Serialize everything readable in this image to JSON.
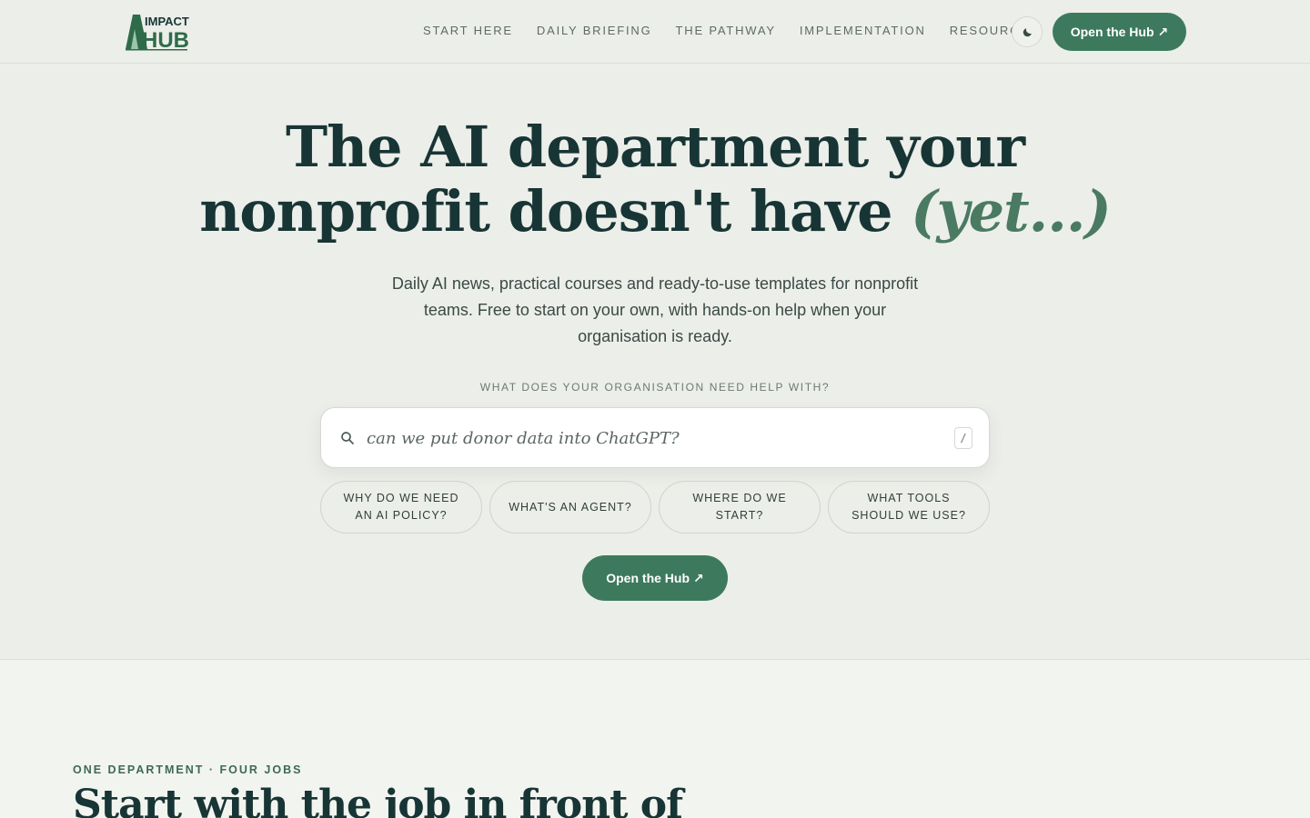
{
  "brand": {
    "logo_line1": "IMPACT",
    "logo_line2": "HUB",
    "brand_color": "#2f6b4a"
  },
  "nav": {
    "items": [
      {
        "label": "START HERE"
      },
      {
        "label": "DAILY BRIEFING"
      },
      {
        "label": "THE PATHWAY"
      },
      {
        "label": "IMPLEMENTATION"
      },
      {
        "label": "RESOURCES"
      }
    ],
    "theme_toggle_icon": "moon-icon",
    "cta_label": "Open the Hub",
    "cta_icon": "↗"
  },
  "hero": {
    "title_line1": "The AI department your",
    "title_line2": "nonprofit doesn't have",
    "title_accent": "(yet...)",
    "subtitle": "Daily AI news, practical courses and ready-to-use templates for nonprofit teams. Free to start on your own, with hands-on help when your organisation is ready.",
    "prompt_label": "WHAT DOES YOUR ORGANISATION NEED HELP WITH?",
    "search": {
      "value": "can we put donor data into ChatGPT?",
      "shortcut": "/",
      "icon": "search-icon"
    },
    "chips": [
      {
        "label": "WHY DO WE NEED AN AI POLICY?"
      },
      {
        "label": "WHAT'S AN AGENT?"
      },
      {
        "label": "WHERE DO WE START?"
      },
      {
        "label": "WHAT TOOLS SHOULD WE USE?"
      }
    ],
    "cta_label": "Open the Hub",
    "cta_icon": "↗"
  },
  "section": {
    "eyebrow": "ONE DEPARTMENT · FOUR JOBS",
    "title": "Start with the job in front of"
  },
  "colors": {
    "accent": "#3d7a5d",
    "background": "#eceee9",
    "heading": "#183535"
  }
}
